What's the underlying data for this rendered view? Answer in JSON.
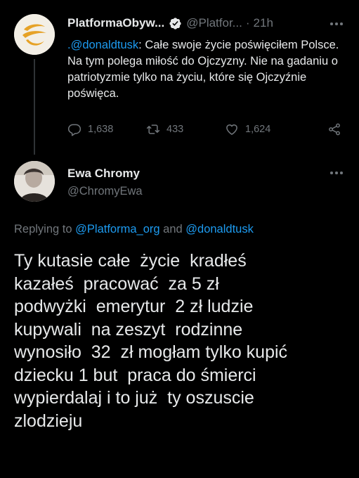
{
  "parent_tweet": {
    "display_name": "PlatformaObyw...",
    "handle": "@Platfor...",
    "separator": "·",
    "time": "21h",
    "text_mention": ".@donaldtusk",
    "text_rest": ": Całe swoje życie poświęciłem Polsce. Na tym polega miłość do Ojczyzny. Nie na gadaniu o patriotyzmie tylko na życiu, które się Ojczyźnie poświęca.",
    "replies_count": "1,638",
    "retweets_count": "433",
    "likes_count": "1,624"
  },
  "reply_tweet": {
    "display_name": "Ewa Chromy",
    "handle": "@ChromyEwa",
    "replying_prefix": "Replying to",
    "replying_mention_1": "@Platforma_org",
    "replying_and": "and",
    "replying_mention_2": "@donaldtusk",
    "body_lines": [
      "Ty kutasie całe  życie  kradłeś",
      "kazałeś  pracować  za 5 zł",
      "podwyżki  emerytur  2 zł ludzie",
      "kupywali  na zeszyt  rodzinne",
      "wynosiło  32  zł mogłam tylko kupić",
      "dziecku 1 but  praca do śmierci",
      "wypierdalaj i to już  ty oszuscie",
      "zlodzieju"
    ]
  },
  "colors": {
    "background": "#000000",
    "text": "#e7e9ea",
    "muted": "#71767b",
    "link": "#1d9bf0",
    "verified_badge": "#e7e9ea"
  }
}
